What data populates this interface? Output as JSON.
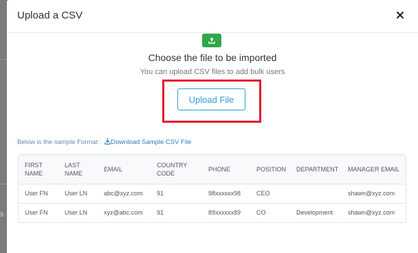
{
  "backdrop": {
    "fragment": "9"
  },
  "modal": {
    "title": "Upload a CSV",
    "close_icon": "close-icon",
    "upload_icon": "upload-icon",
    "heading": "Choose the file to be imported",
    "subtext": "You can upload CSV files to add bulk users",
    "upload_button_label": "Upload File",
    "sample_label": "Below is the sample Format :",
    "download_label": "Download Sample CSV File",
    "download_icon": "download-icon",
    "colors": {
      "accent": "#2a9fd0",
      "badge": "#2ea84a",
      "highlight": "#e5172b"
    }
  },
  "table": {
    "headers": [
      [
        "FIRST",
        "NAME"
      ],
      [
        "LAST",
        "NAME"
      ],
      [
        "EMAIL"
      ],
      [
        "COUNTRY",
        "CODE"
      ],
      [
        "PHONE"
      ],
      [
        "POSITION"
      ],
      [
        "DEPARTMENT"
      ],
      [
        "MANAGER EMAIL"
      ]
    ],
    "rows": [
      [
        "User FN",
        "User LN",
        "abc@xyz.com",
        "91",
        "98xxxxxx98",
        "CEO",
        "",
        "shawn@xyz.com"
      ],
      [
        "User FN",
        "User LN",
        "xyz@abc.com",
        "91",
        "89xxxxxx89",
        "CO",
        "Development",
        "shawn@xyz.com"
      ]
    ]
  }
}
